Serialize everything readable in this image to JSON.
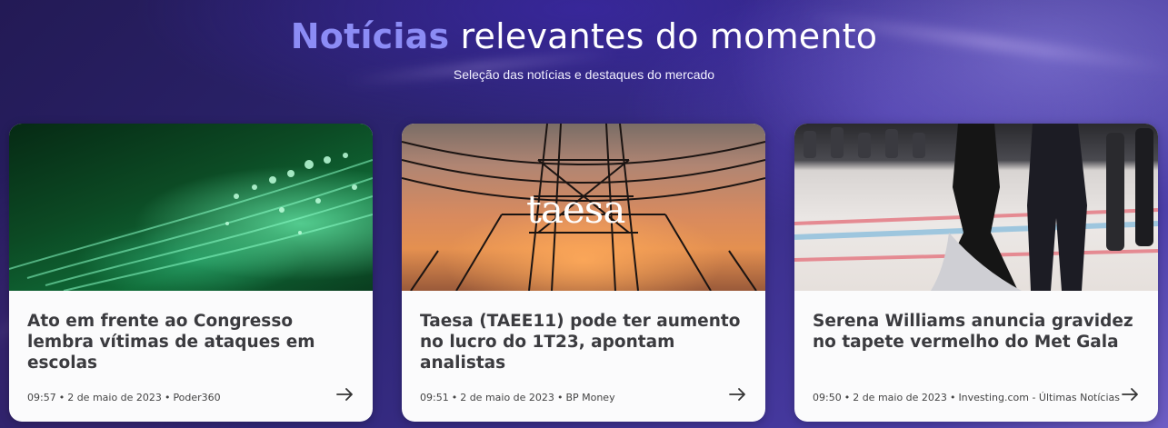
{
  "header": {
    "title_accent": "Notícias",
    "title_rest": " relevantes do momento",
    "subtitle": "Seleção das notícias e destaques do mercado"
  },
  "colors": {
    "accent": "#8c8cf5",
    "card_bg": "#fbfbfc",
    "card_title": "#3b3b3f"
  },
  "cards": [
    {
      "image": "green-abstract-image",
      "title": "Ato em frente ao Congresso lembra vítimas de ataques em escolas",
      "time": "09:57",
      "date": "2 de maio de 2023",
      "source": "Poder360",
      "icon": "arrow-right-icon"
    },
    {
      "image": "power-lines-sunset-image",
      "logo_text": "taesa",
      "title": "Taesa (TAEE11) pode ter aumento no lucro do 1T23, apontam analistas",
      "time": "09:51",
      "date": "2 de maio de 2023",
      "source": "BP Money",
      "icon": "arrow-right-icon"
    },
    {
      "image": "met-gala-red-carpet-image",
      "title": "Serena Williams anuncia gravidez no tapete vermelho do Met Gala",
      "time": "09:50",
      "date": "2 de maio de 2023",
      "source": "Investing.com - Últimas Notícias",
      "icon": "arrow-right-icon"
    }
  ]
}
